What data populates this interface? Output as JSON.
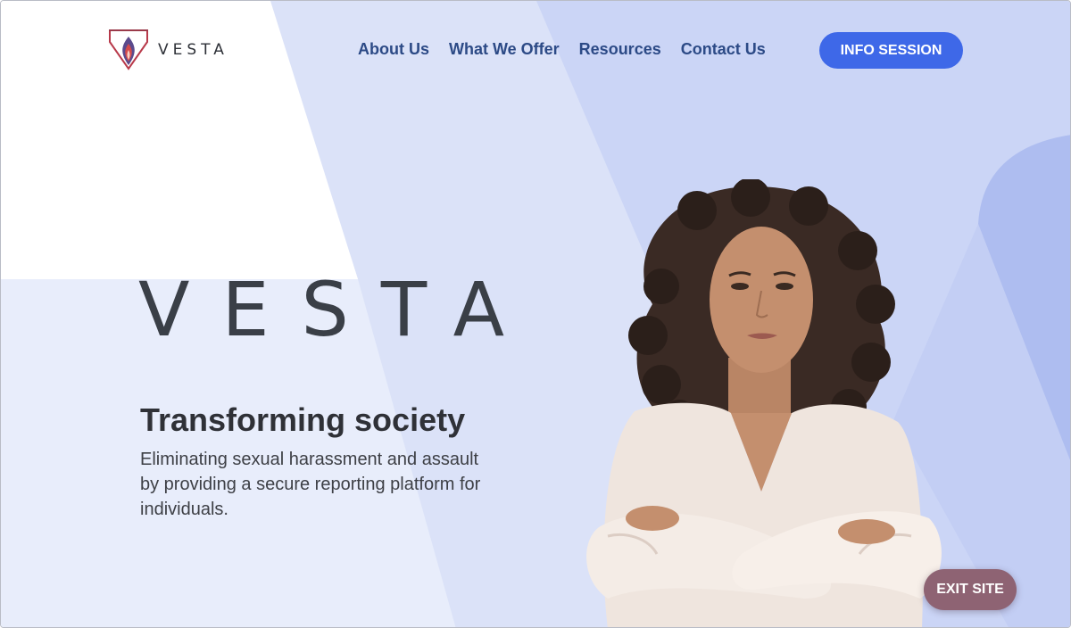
{
  "header": {
    "brand": "VESTA",
    "nav": [
      "About Us",
      "What We Offer",
      "Resources",
      "Contact Us"
    ],
    "cta_label": "INFO SESSION"
  },
  "hero": {
    "wordmark": "VESTA",
    "title": "Transforming society",
    "description": "Eliminating sexual harassment and assault by providing a secure reporting platform for individuals."
  },
  "exit_label": "EXIT SITE",
  "icons": {
    "logo": "vesta-flame-shield-logo"
  },
  "colors": {
    "nav_text": "#2c4a86",
    "cta_bg": "#3e68e8",
    "exit_bg": "#8e6373",
    "bg_light": "#e6ebfa",
    "bg_mid": "#d6ddf6",
    "bg_accent": "#c5d0f4",
    "bg_deep": "#a9b9ef"
  }
}
